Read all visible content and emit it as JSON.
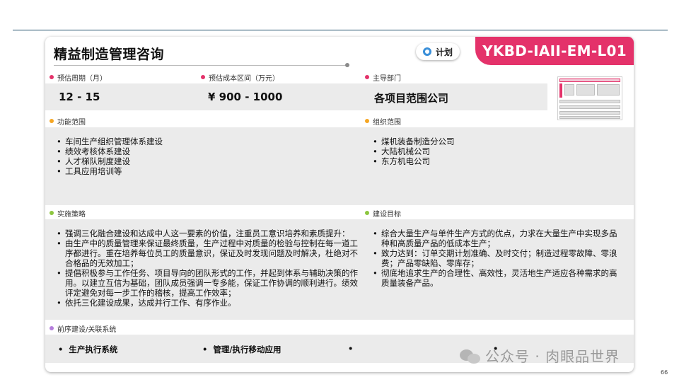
{
  "header": {
    "title": "精益制造管理咨询",
    "status_label": "计划",
    "code": "YKBD-IAII-EM-L01"
  },
  "colors": {
    "accent_pink": "#e4326a",
    "bullet_red": "#e4326a",
    "bullet_orange": "#f5a623",
    "bullet_green": "#8cc63f",
    "bullet_purple": "#b57edc",
    "plan_ring": "#3a8fd9"
  },
  "summary": {
    "period_label": "预估周期（月）",
    "period_value": "12 - 15",
    "cost_label": "预估成本区间（万元）",
    "cost_value": "¥ 900 - 1000",
    "dept_label": "主导部门",
    "dept_value": "各项目范围公司"
  },
  "function_scope": {
    "label": "功能范围",
    "items": [
      "车间生产组织管理体系建设",
      "绩效考核体系建设",
      "人才梯队制度建设",
      "工具应用培训等"
    ]
  },
  "org_scope": {
    "label": "组织范围",
    "items": [
      "煤机装备制造分公司",
      "大陆机械公司",
      "东方机电公司"
    ]
  },
  "strategy": {
    "label": "实施策略",
    "items": [
      "强调三化融合建设和达成中人这一要素的价值，注重员工意识培养和素质提升：",
      "由生产中的质量管理来保证最终质量，生产过程中对质量的检验与控制在每一道工序都进行。重在培养每位员工的质量意识，保证及时发现问题及时解决，杜绝对不合格品的无效加工；",
      "提倡积极参与工作任务、项目导向的团队形式的工作，并起到体系与辅助决策的作用。以建立互信为基础，团队成员强调一专多能，保证工作协调的顺利进行。绩效评定避免对每一步工作的稽核，提高工作效率；",
      "依托三化建设成果，达成并行工作、有序作业。"
    ]
  },
  "goals": {
    "label": "建设目标",
    "items": [
      "综合大量生产与单件生产方式的优点，力求在大量生产中实现多品种和高质量产品的低成本生产；",
      "致力达到：订单交期计划准确、及时交付；制造过程零故障、零浪费；产品零缺陷、零库存；",
      "彻底地追求生产的合理性、高效性，灵活地生产适应各种需求的高质量装备产品。"
    ]
  },
  "related_systems": {
    "label": "前序建设/关联系统",
    "items": [
      "生产执行系统",
      "管理/执行移动应用",
      "",
      ""
    ]
  },
  "watermark": "公众号 · 肉眼品世界",
  "page_number": "66"
}
